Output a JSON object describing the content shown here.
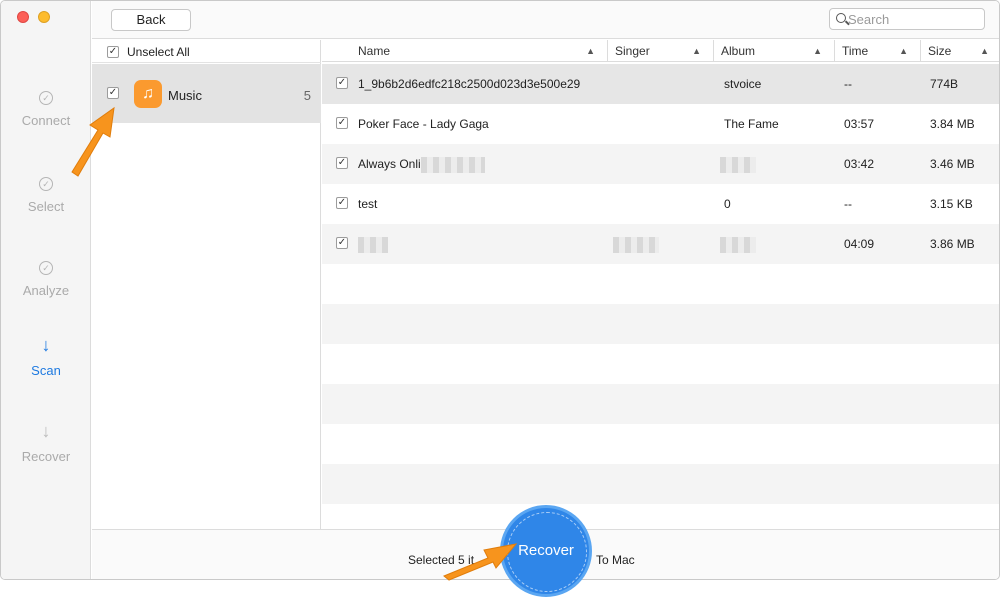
{
  "toolbar": {
    "back_label": "Back",
    "search_placeholder": "Search"
  },
  "steps": [
    {
      "label": "Connect",
      "state": "done",
      "icon": "check-circle-icon"
    },
    {
      "label": "Select",
      "state": "done",
      "icon": "check-circle-icon"
    },
    {
      "label": "Analyze",
      "state": "done",
      "icon": "check-circle-icon"
    },
    {
      "label": "Scan",
      "state": "active",
      "icon": "down-arrow-icon"
    },
    {
      "label": "Recover",
      "state": "pending",
      "icon": "down-arrow-icon"
    }
  ],
  "categories": {
    "unselect_label": "Unselect All",
    "items": [
      {
        "label": "Music",
        "count": "5",
        "icon": "music-note-icon",
        "checked": true
      }
    ]
  },
  "table": {
    "columns": [
      "Name",
      "Singer",
      "Album",
      "Time",
      "Size"
    ],
    "rows": [
      {
        "name": "1_9b6b2d6edfc218c2500d023d3e500e29",
        "singer": "",
        "album": "stvoice",
        "time": "--",
        "size": "774B",
        "checked": true
      },
      {
        "name": "Poker Face - Lady Gaga",
        "singer": "",
        "album": "The Fame",
        "time": "03:57",
        "size": "3.84 MB",
        "checked": true
      },
      {
        "name": "Always Onli",
        "singer": "",
        "album": "",
        "time": "03:42",
        "size": "3.46 MB",
        "checked": true
      },
      {
        "name": "test",
        "singer": "",
        "album": "0",
        "time": "--",
        "size": "3.15 KB",
        "checked": true
      },
      {
        "name": "",
        "singer": "",
        "album": "",
        "time": "04:09",
        "size": "3.86 MB",
        "checked": true
      }
    ]
  },
  "footer": {
    "selected_text": "Selected 5 it",
    "to_mac": "To Mac",
    "recover_label": "Recover"
  },
  "colors": {
    "accent": "#1f7ae0",
    "recover_button": "#2f86e8",
    "music_app": "#fb9a2f",
    "pointer": "#f7941d"
  }
}
